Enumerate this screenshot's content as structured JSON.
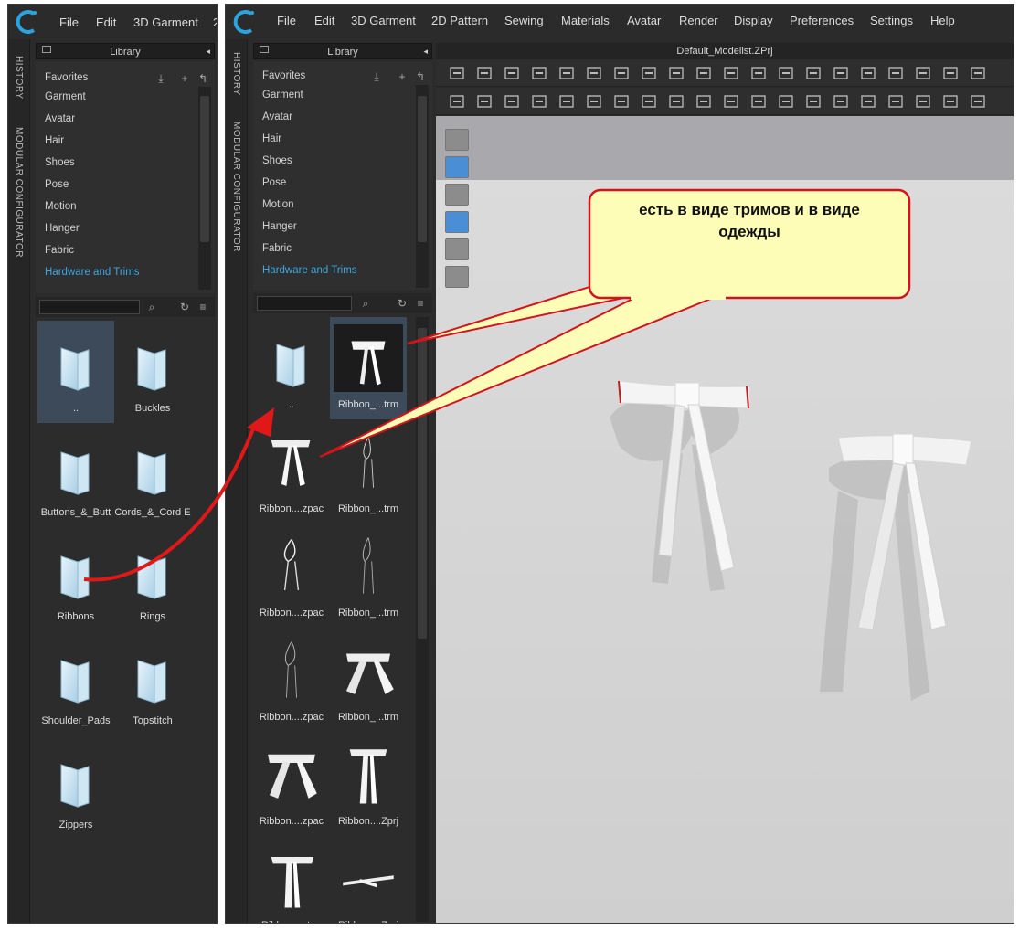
{
  "left_window": {
    "menu": [
      "File",
      "Edit",
      "3D Garment",
      "2"
    ],
    "side_tabs": [
      "HISTORY",
      "MODULAR CONFIGURATOR"
    ],
    "library_title": "Library",
    "library_items": [
      "Favorites",
      "Garment",
      "Avatar",
      "Hair",
      "Shoes",
      "Pose",
      "Motion",
      "Hanger",
      "Fabric",
      "Hardware and Trims"
    ],
    "active_item": "Hardware and Trims",
    "folders": [
      "..",
      "Buckles",
      "Buttons_&_Butt",
      "Cords_&_Cord E",
      "Ribbons",
      "Rings",
      "Shoulder_Pads",
      "Topstitch",
      "Zippers"
    ]
  },
  "right_window": {
    "menu": [
      "File",
      "Edit",
      "3D Garment",
      "2D Pattern",
      "Sewing",
      "Materials",
      "Avatar",
      "Render",
      "Display",
      "Preferences",
      "Settings",
      "Help"
    ],
    "side_tabs": [
      "HISTORY",
      "MODULAR CONFIGURATOR"
    ],
    "library_title": "Library",
    "library_items": [
      "Favorites",
      "Garment",
      "Avatar",
      "Hair",
      "Shoes",
      "Pose",
      "Motion",
      "Hanger",
      "Fabric",
      "Hardware and Trims"
    ],
    "active_item": "Hardware and Trims",
    "files": [
      "..",
      "Ribbon_...trm",
      "Ribbon....zpac",
      "Ribbon_...trm",
      "Ribbon....zpac",
      "Ribbon_...trm",
      "Ribbon....zpac",
      "Ribbon_...trm",
      "Ribbon....zpac",
      "Ribbon....Zprj",
      "Ribbon_...trm",
      "Ribbon....Zprj"
    ],
    "document_title": "Default_Modelist.ZPrj"
  },
  "annotation": {
    "callout_line1": "есть в виде тримов и в виде",
    "callout_line2": "одежды"
  },
  "colors": {
    "panel_bg": "#2b2b2b",
    "accent_blue": "#3fa7e0",
    "callout_fill": "#fdfdb8",
    "callout_border": "#d4141c",
    "arrow_red": "#e01818"
  },
  "icons": [
    "clo-logo-icon",
    "folder-icon",
    "search-icon",
    "refresh-icon",
    "list-view-icon",
    "download-icon",
    "add-icon",
    "back-icon",
    "popout-icon"
  ]
}
